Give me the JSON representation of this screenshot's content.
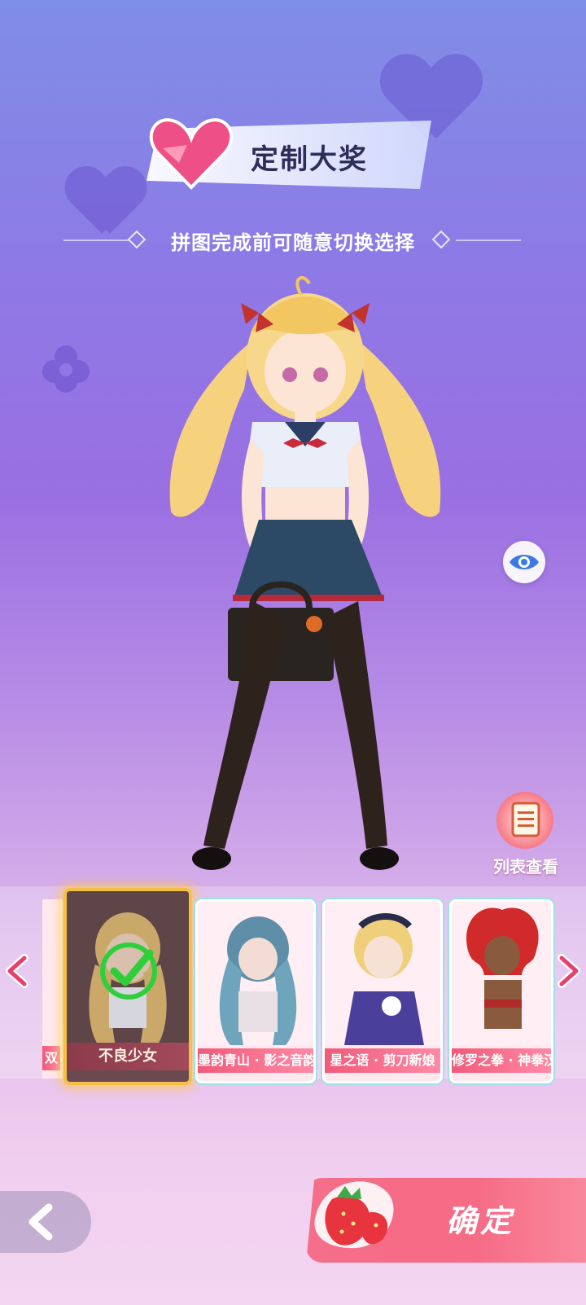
{
  "header": {
    "title": "定制大奖",
    "subtitle": "拼图完成前可随意切换选择"
  },
  "side_buttons": {
    "eye_icon": "eye-icon",
    "list_label": "列表查看"
  },
  "carousel": {
    "cards": [
      {
        "label": "不良少女",
        "selected": true
      },
      {
        "label": "墨韵青山 · 影之音韵",
        "selected": false
      },
      {
        "label": "星之语 · 剪刀新娘",
        "selected": false
      },
      {
        "label": "修罗之拳 · 神拳汉",
        "selected": false
      }
    ],
    "partial_left_label": "双"
  },
  "footer": {
    "back_icon": "chevron-left-icon",
    "confirm_label": "确定"
  },
  "colors": {
    "accent_pink": "#f05a7a",
    "selected_border": "#f5c04a",
    "check_green": "#2ecf3a"
  }
}
